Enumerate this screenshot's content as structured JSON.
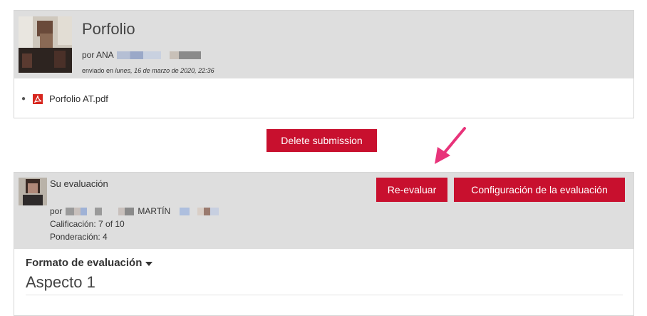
{
  "submission": {
    "title": "Porfolio",
    "by_prefix": "por ANA",
    "sent_prefix": "enviado en ",
    "sent_date": "lunes, 16 de marzo de 2020, 22:36",
    "file": {
      "name": "Porfolio AT.pdf",
      "icon": "pdf-icon"
    },
    "delete_label": "Delete submission"
  },
  "evaluation": {
    "label": "Su evaluación",
    "by_prefix": "por",
    "by_name": "MARTÍN",
    "grade": "Calificación: 7 of 10",
    "weight": "Ponderación: 4",
    "reevaluate_label": "Re-evaluar",
    "config_label": "Configuración de la evaluación",
    "format_label": "Formato de evaluación",
    "aspect_title": "Aspecto 1"
  },
  "colors": {
    "accent": "#c8102e",
    "arrow": "#e8337a",
    "header_bg": "#dedede"
  }
}
